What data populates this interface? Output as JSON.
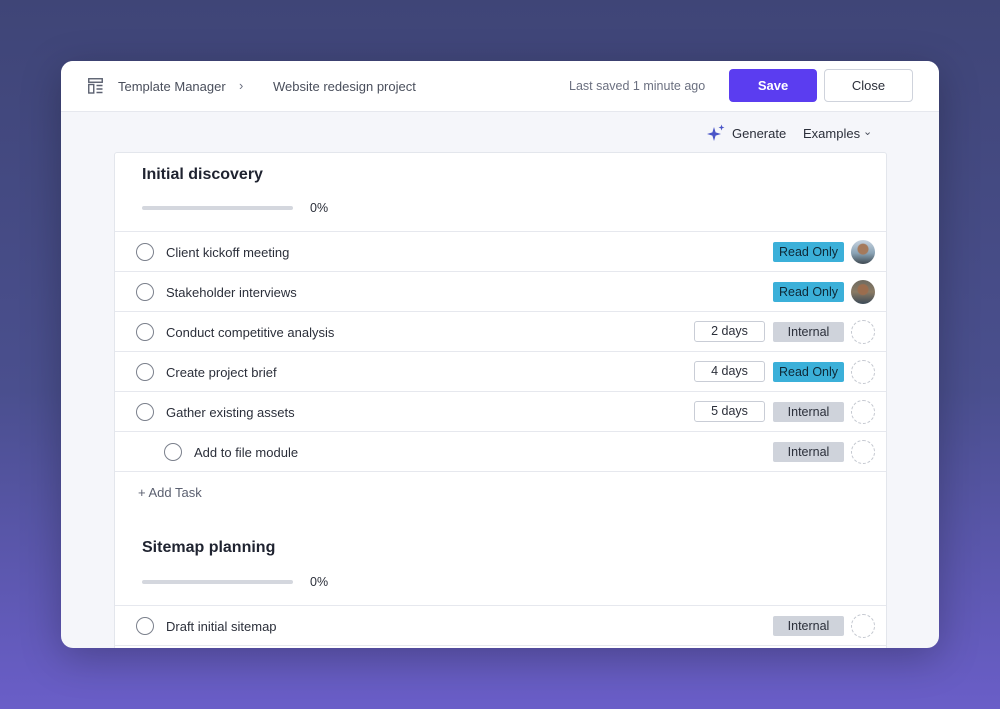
{
  "header": {
    "breadcrumb_root": "Template Manager",
    "breadcrumb_current": "Website redesign project",
    "saved_status": "Last saved 1 minute ago",
    "save_label": "Save",
    "close_label": "Close"
  },
  "toolbar": {
    "generate_label": "Generate",
    "examples_label": "Examples"
  },
  "sections": [
    {
      "title": "Initial discovery",
      "progress": 0,
      "progress_label": "0%",
      "tasks": [
        {
          "label": "Client kickoff meeting",
          "duration": "",
          "badge": "Read Only",
          "assignee": "photo1"
        },
        {
          "label": "Stakeholder interviews",
          "duration": "",
          "badge": "Read Only",
          "assignee": "photo2"
        },
        {
          "label": "Conduct competitive analysis",
          "duration": "2 days",
          "badge": "Internal",
          "assignee": "empty"
        },
        {
          "label": "Create project brief",
          "duration": "4 days",
          "badge": "Read Only",
          "assignee": "empty"
        },
        {
          "label": "Gather existing assets",
          "duration": "5 days",
          "badge": "Internal",
          "assignee": "empty"
        },
        {
          "label": "Add to file module",
          "duration": "",
          "badge": "Internal",
          "assignee": "empty",
          "subtask": true
        }
      ],
      "add_task_label": "+ Add Task"
    },
    {
      "title": "Sitemap planning",
      "progress": 0,
      "progress_label": "0%",
      "tasks": [
        {
          "label": "Draft initial sitemap",
          "duration": "",
          "badge": "Internal",
          "assignee": "empty"
        }
      ]
    }
  ],
  "colors": {
    "accent": "#5b3df0",
    "read_only_badge": "#3bb0d9",
    "internal_badge": "#cfd3db"
  }
}
